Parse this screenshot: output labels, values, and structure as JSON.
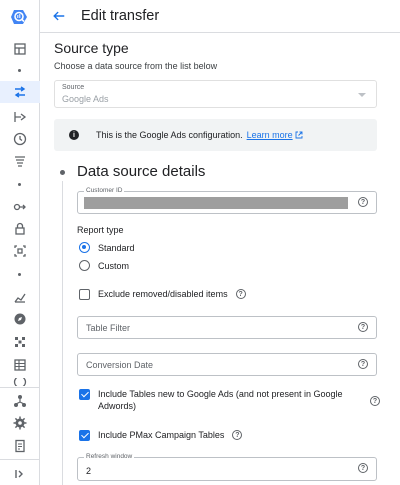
{
  "header": {
    "title": "Edit transfer"
  },
  "source": {
    "section_title": "Source type",
    "subtitle": "Choose a data source from the list below",
    "field_label": "Source",
    "field_value": "Google Ads"
  },
  "banner": {
    "text": "This is the Google Ads configuration.",
    "link": "Learn more"
  },
  "details": {
    "title": "Data source details",
    "customer_id_label": "Customer ID",
    "report_type_label": "Report type",
    "report_types": [
      {
        "label": "Standard",
        "selected": true
      },
      {
        "label": "Custom",
        "selected": false
      }
    ],
    "exclude_label": "Exclude removed/disabled items",
    "exclude_checked": false,
    "table_filter_placeholder": "Table Filter",
    "conversion_date_placeholder": "Conversion Date",
    "include_new_tables_label_1": "Include Tables new to Google Ads (and not present in Google",
    "include_new_tables_label_2": "Adwords)",
    "include_new_tables_checked": true,
    "include_pmax_label": "Include PMax Campaign Tables",
    "include_pmax_checked": true,
    "refresh_window_label": "Refresh window",
    "refresh_window_value": "2"
  },
  "colors": {
    "accent": "#1a73e8",
    "banner_bg": "#f1f3f4",
    "redacted": "#9e9e9e"
  },
  "icons": {
    "rail": [
      "bigquery-logo",
      "dashboard-icon",
      "transfers-icon",
      "pipeline-icon",
      "history-icon",
      "list-icon",
      "analytics-hub-icon",
      "lock-icon",
      "partner-center-icon",
      "monitoring-icon",
      "explore-icon",
      "resource-icon",
      "table-icon",
      "deploy-icon",
      "settings-icon",
      "release-notes-icon",
      "expand-icon"
    ]
  }
}
